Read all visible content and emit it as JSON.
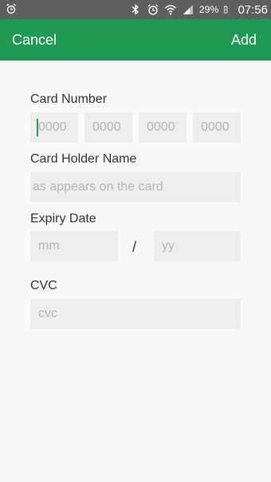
{
  "status_bar": {
    "battery": "29%",
    "time": "07:56",
    "icons": [
      "alarm-icon",
      "bluetooth-icon",
      "alarm-icon",
      "wifi-icon",
      "signal-icon",
      "battery-icon"
    ]
  },
  "app_bar": {
    "cancel_label": "Cancel",
    "add_label": "Add",
    "color": "#1f9a55"
  },
  "form": {
    "card_number": {
      "label": "Card Number",
      "segments": [
        "0000",
        "0000",
        "0000",
        "0000"
      ]
    },
    "card_holder": {
      "label": "Card Holder Name",
      "placeholder": "as appears on the card"
    },
    "expiry": {
      "label": "Expiry Date",
      "month_placeholder": "mm",
      "separator": "/",
      "year_placeholder": "yy"
    },
    "cvc": {
      "label": "CVC",
      "placeholder": "cvc"
    }
  }
}
